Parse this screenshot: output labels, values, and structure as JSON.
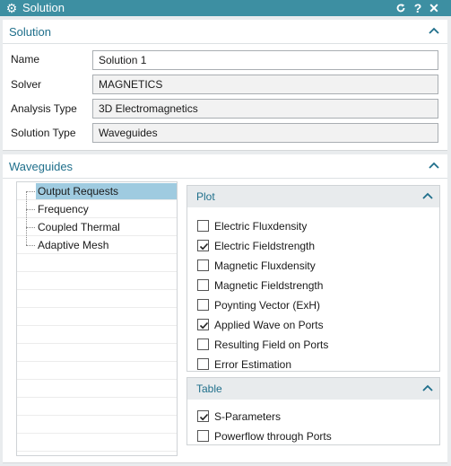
{
  "window": {
    "title": "Solution"
  },
  "solution": {
    "title": "Solution",
    "fields": [
      {
        "label": "Name",
        "value": "Solution 1"
      },
      {
        "label": "Solver",
        "value": "MAGNETICS"
      },
      {
        "label": "Analysis Type",
        "value": "3D Electromagnetics"
      },
      {
        "label": "Solution Type",
        "value": "Waveguides"
      }
    ]
  },
  "waveguides": {
    "title": "Waveguides",
    "tree": [
      "Output Requests",
      "Frequency",
      "Coupled Thermal",
      "Adaptive Mesh"
    ],
    "selected": "Output Requests",
    "plot": {
      "title": "Plot",
      "options": [
        {
          "label": "Electric Fluxdensity",
          "checked": false
        },
        {
          "label": "Electric Fieldstrength",
          "checked": true
        },
        {
          "label": "Magnetic Fluxdensity",
          "checked": false
        },
        {
          "label": "Magnetic Fieldstrength",
          "checked": false
        },
        {
          "label": "Poynting Vector (ExH)",
          "checked": false
        },
        {
          "label": "Applied Wave on Ports",
          "checked": true
        },
        {
          "label": "Resulting Field on Ports",
          "checked": false
        },
        {
          "label": "Error Estimation",
          "checked": false
        }
      ]
    },
    "table": {
      "title": "Table",
      "options": [
        {
          "label": "S-Parameters",
          "checked": true
        },
        {
          "label": "Powerflow through Ports",
          "checked": false
        }
      ]
    }
  },
  "colors": {
    "titlebar": "#3d8fa2",
    "accent": "#1f6f8b",
    "selection": "#9fcbe0"
  }
}
